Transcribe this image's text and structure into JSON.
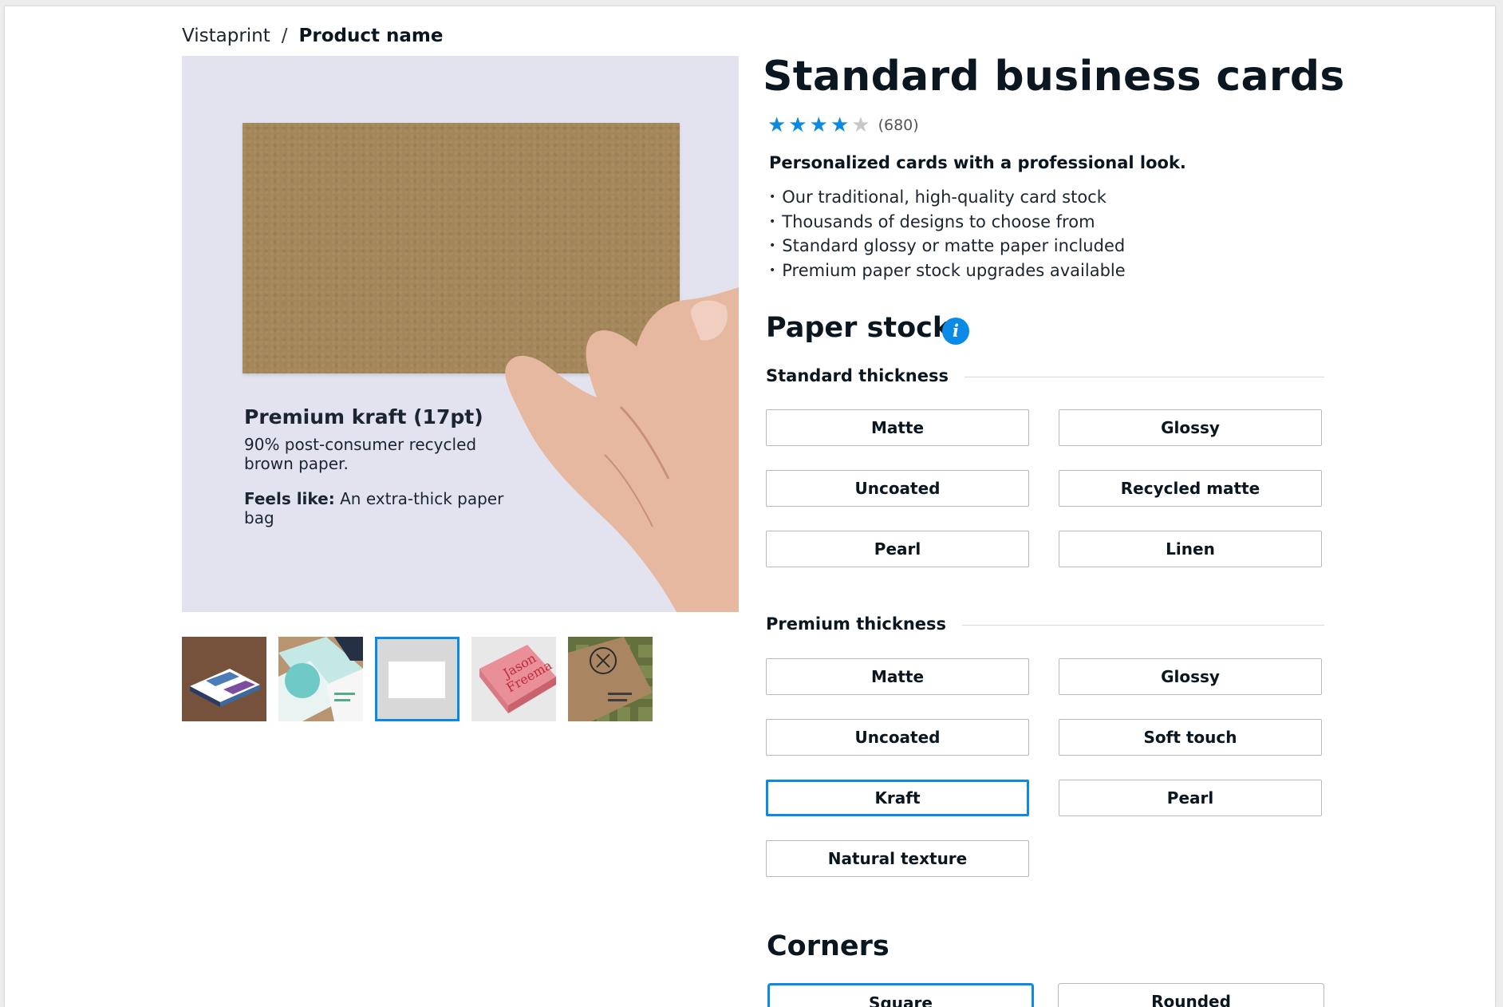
{
  "breadcrumb": {
    "home": "Vistaprint",
    "separator": "/",
    "current": "Product name"
  },
  "hero": {
    "title": "Premium kraft (17pt)",
    "description": "90% post-consumer recycled brown paper.",
    "feels_like_label": "Feels like:",
    "feels_like_value": " An extra-thick paper bag"
  },
  "thumbnails_selected_index": 2,
  "product": {
    "title": "Standard business cards",
    "rating": 4,
    "rating_max": 5,
    "review_count": "(680)",
    "tagline": "Personalized cards with a professional look.",
    "bullets": [
      "Our traditional, high-quality card stock",
      "Thousands of designs to choose from",
      "Standard glossy or matte paper included",
      "Premium paper stock upgrades available"
    ]
  },
  "paper_stock": {
    "heading": "Paper stock",
    "standard": {
      "label": "Standard thickness",
      "options": [
        "Matte",
        "Glossy",
        "Uncoated",
        "Recycled matte",
        "Pearl",
        "Linen"
      ]
    },
    "premium": {
      "label": "Premium thickness",
      "options": [
        "Matte",
        "Glossy",
        "Uncoated",
        "Soft touch",
        "Kraft",
        "Pearl",
        "Natural texture"
      ],
      "selected": "Kraft"
    }
  },
  "corners": {
    "heading": "Corners",
    "options": [
      "Square",
      "Rounded"
    ],
    "selected": "Square"
  },
  "colors": {
    "accent": "#0a8ae6",
    "kraft": "#a38659"
  }
}
